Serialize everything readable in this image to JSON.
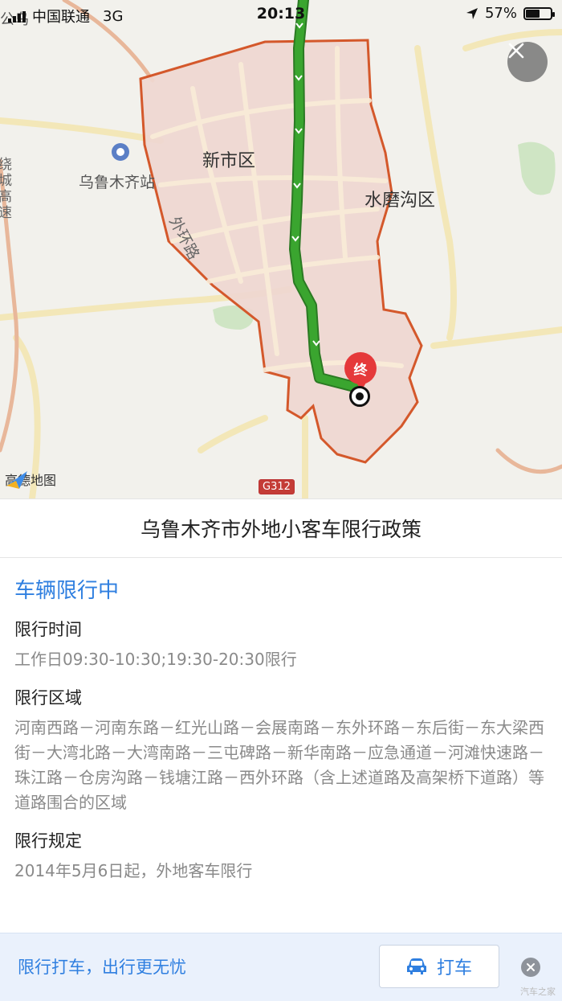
{
  "status_bar": {
    "carrier": "中国联通",
    "network": "3G",
    "time": "20:13",
    "battery": "57%",
    "battery_level": 0.57
  },
  "map": {
    "labels": {
      "district_xinshi": "新市区",
      "district_shuimogou": "水磨沟区",
      "station": "乌鲁木齐站",
      "ring_road": "外环路",
      "highway_left": "绕城高速",
      "top_left_fragment": "公乌"
    },
    "end_marker": "终",
    "brand": "高德地图",
    "road_badge": "G312",
    "colors": {
      "route": "#3aa52f",
      "zone_fill": "#efd7d0",
      "zone_border": "#d4582b"
    }
  },
  "title": "乌鲁木齐市外地小客车限行政策",
  "status": {
    "text": "车辆限行中",
    "color": "#2f7fe0"
  },
  "sections": [
    {
      "title": "限行时间",
      "text": "工作日09:30-10:30;19:30-20:30限行"
    },
    {
      "title": "限行区域",
      "text": "河南西路－河南东路－红光山路－会展南路－东外环路－东后街－东大梁西街－大湾北路－大湾南路－三屯碑路－新华南路－应急通道－河滩快速路－珠江路－仓房沟路－钱塘江路－西外环路（含上述道路及高架桥下道路）等道路围合的区域"
    },
    {
      "title": "限行规定",
      "text": "2014年5月6日起，外地客车限行"
    }
  ],
  "bottom_bar": {
    "promo": "限行打车，出行更无忧",
    "taxi_button": "打车"
  },
  "watermark": "汽车之家"
}
